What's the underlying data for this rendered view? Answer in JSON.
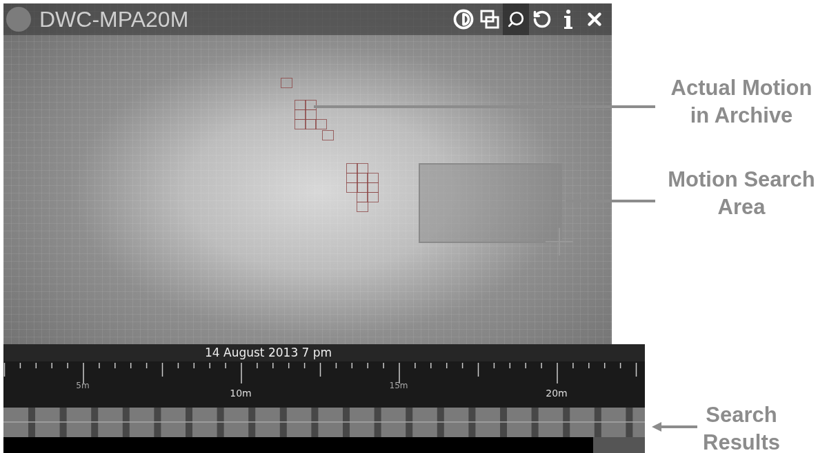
{
  "camera": {
    "title": "DWC-MPA20M"
  },
  "toolbar": [
    {
      "kind": "contrast",
      "selected": false
    },
    {
      "kind": "windows",
      "selected": false
    },
    {
      "kind": "search",
      "selected": true
    },
    {
      "kind": "rotate",
      "selected": false
    },
    {
      "kind": "info",
      "selected": false
    },
    {
      "kind": "close",
      "selected": false
    }
  ],
  "timeline": {
    "date": "14 August 2013 7 pm",
    "labels": [
      {
        "text": "5m",
        "major": false
      },
      {
        "text": "10m",
        "major": true
      },
      {
        "text": "15m",
        "major": false
      },
      {
        "text": "20m",
        "major": true
      }
    ]
  },
  "annotations": [
    {
      "lines": [
        "Actual Motion",
        "in Archive"
      ]
    },
    {
      "lines": [
        "Motion Search",
        "Area"
      ]
    },
    {
      "lines": [
        "Search",
        "Results"
      ]
    }
  ]
}
